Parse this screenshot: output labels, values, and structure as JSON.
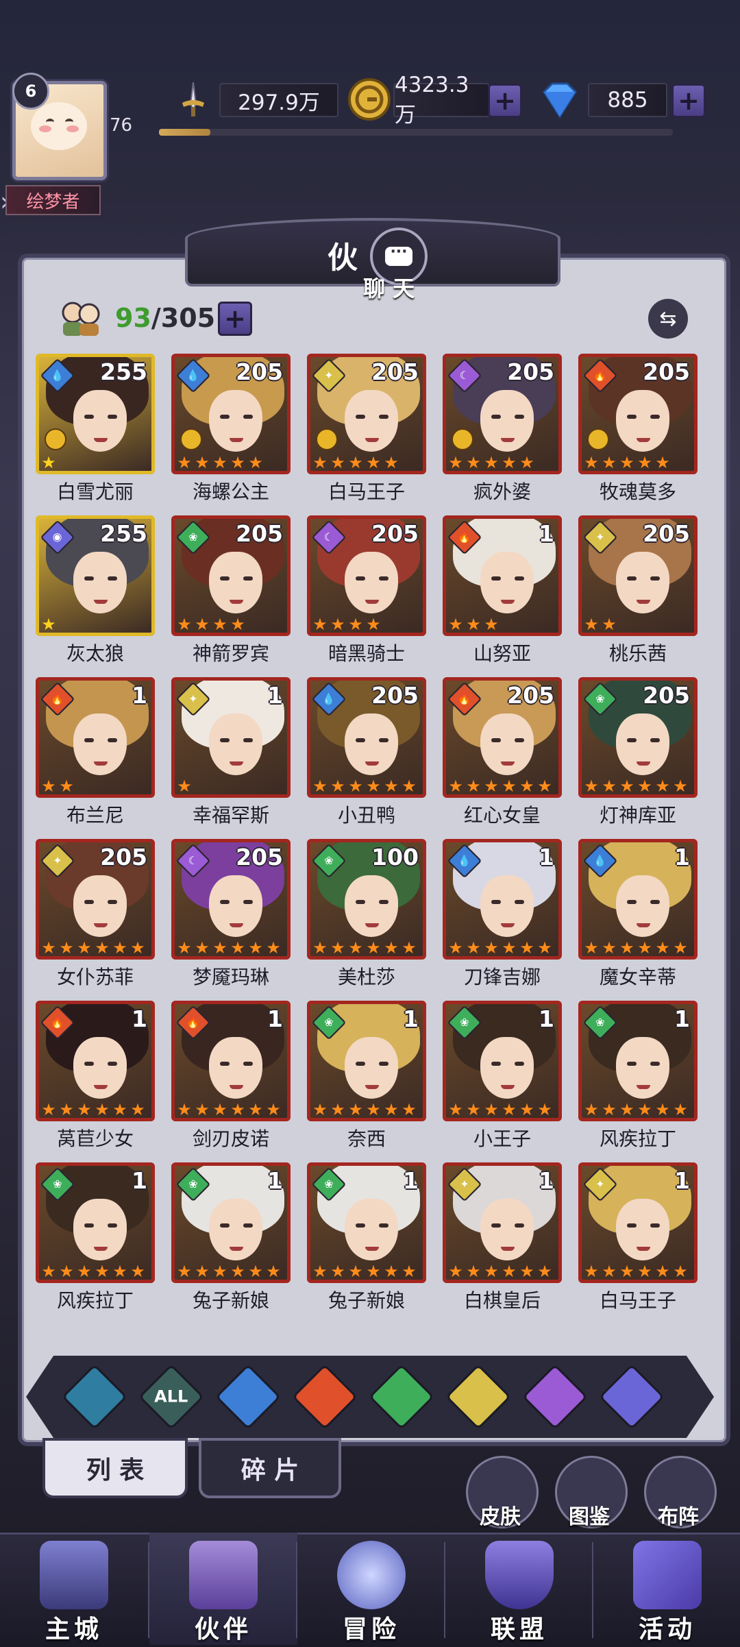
{
  "header": {
    "player_level": "6",
    "exp_value": "76",
    "exp_progress": 0.1,
    "player_name": "绘梦者",
    "power": "297.9万",
    "gold": "4323.3万",
    "gems": "885"
  },
  "panel": {
    "title": "伙",
    "chat_label": "聊 天",
    "count_current": "93",
    "count_total": "/305"
  },
  "heroes": [
    {
      "name": "白雪尤丽",
      "level": "255",
      "element": "water",
      "stars": 1,
      "frame": "gold",
      "crown": true
    },
    {
      "name": "海螺公主",
      "level": "205",
      "element": "water",
      "stars": 5,
      "frame": "red",
      "crown": true
    },
    {
      "name": "白马王子",
      "level": "205",
      "element": "light",
      "stars": 5,
      "frame": "red",
      "crown": true
    },
    {
      "name": "疯外婆",
      "level": "205",
      "element": "dark",
      "stars": 5,
      "frame": "red",
      "crown": true
    },
    {
      "name": "牧魂莫多",
      "level": "205",
      "element": "fire",
      "stars": 5,
      "frame": "red",
      "crown": true
    },
    {
      "name": "灰太狼",
      "level": "255",
      "element": "void",
      "stars": 1,
      "frame": "gold",
      "crown": false
    },
    {
      "name": "神箭罗宾",
      "level": "205",
      "element": "wind",
      "stars": 4,
      "frame": "red",
      "crown": false
    },
    {
      "name": "暗黑骑士",
      "level": "205",
      "element": "dark",
      "stars": 4,
      "frame": "red",
      "crown": false
    },
    {
      "name": "山努亚",
      "level": "1",
      "element": "fire",
      "stars": 3,
      "frame": "red",
      "crown": false
    },
    {
      "name": "桃乐茜",
      "level": "205",
      "element": "light",
      "stars": 2,
      "frame": "red",
      "crown": false
    },
    {
      "name": "布兰尼",
      "level": "1",
      "element": "fire",
      "stars": 2,
      "frame": "red",
      "crown": false
    },
    {
      "name": "幸福罕斯",
      "level": "1",
      "element": "light",
      "stars": 1,
      "frame": "red",
      "crown": false
    },
    {
      "name": "小丑鸭",
      "level": "205",
      "element": "water",
      "stars": 6,
      "frame": "red",
      "crown": false
    },
    {
      "name": "红心女皇",
      "level": "205",
      "element": "fire",
      "stars": 6,
      "frame": "red",
      "crown": false
    },
    {
      "name": "灯神库亚",
      "level": "205",
      "element": "wind",
      "stars": 6,
      "frame": "red",
      "crown": false
    },
    {
      "name": "女仆苏菲",
      "level": "205",
      "element": "light",
      "stars": 6,
      "frame": "red",
      "crown": false
    },
    {
      "name": "梦魇玛琳",
      "level": "205",
      "element": "dark",
      "stars": 6,
      "frame": "red",
      "crown": false
    },
    {
      "name": "美杜莎",
      "level": "100",
      "element": "wind",
      "stars": 6,
      "frame": "red",
      "crown": false
    },
    {
      "name": "刀锋吉娜",
      "level": "1",
      "element": "water",
      "stars": 6,
      "frame": "red",
      "crown": false
    },
    {
      "name": "魔女辛蒂",
      "level": "1",
      "element": "water",
      "stars": 6,
      "frame": "red",
      "crown": false
    },
    {
      "name": "莴苣少女",
      "level": "1",
      "element": "fire",
      "stars": 6,
      "frame": "red",
      "crown": false
    },
    {
      "name": "剑刃皮诺",
      "level": "1",
      "element": "fire",
      "stars": 6,
      "frame": "red",
      "crown": false
    },
    {
      "name": "奈西",
      "level": "1",
      "element": "wind",
      "stars": 6,
      "frame": "red",
      "crown": false
    },
    {
      "name": "小王子",
      "level": "1",
      "element": "wind",
      "stars": 6,
      "frame": "red",
      "crown": false
    },
    {
      "name": "风疾拉丁",
      "level": "1",
      "element": "wind",
      "stars": 6,
      "frame": "red",
      "crown": false
    },
    {
      "name": "风疾拉丁",
      "level": "1",
      "element": "wind",
      "stars": 6,
      "frame": "red",
      "crown": false
    },
    {
      "name": "兔子新娘",
      "level": "1",
      "element": "wind",
      "stars": 6,
      "frame": "red",
      "crown": false
    },
    {
      "name": "兔子新娘",
      "level": "1",
      "element": "wind",
      "stars": 6,
      "frame": "red",
      "crown": false
    },
    {
      "name": "白棋皇后",
      "level": "1",
      "element": "light",
      "stars": 6,
      "frame": "red",
      "crown": false
    },
    {
      "name": "白马王子",
      "level": "1",
      "element": "light",
      "stars": 6,
      "frame": "red",
      "crown": false
    }
  ],
  "element_colors": {
    "water": "#3d7ed6",
    "light": "#d9c04a",
    "dark": "#9b5bd4",
    "fire": "#e0502a",
    "wind": "#3fae5b",
    "void": "#6b66d8"
  },
  "filters": [
    {
      "name": "all-classes",
      "label": "",
      "color": "#2f7da0"
    },
    {
      "name": "all",
      "label": "ALL",
      "color": "#3a5f5a"
    },
    {
      "name": "water",
      "label": "",
      "color": "#3d7ed6"
    },
    {
      "name": "fire",
      "label": "",
      "color": "#e0502a"
    },
    {
      "name": "wind",
      "label": "",
      "color": "#3fae5b"
    },
    {
      "name": "light",
      "label": "",
      "color": "#d9c04a"
    },
    {
      "name": "dark",
      "label": "",
      "color": "#9b5bd4"
    },
    {
      "name": "void",
      "label": "",
      "color": "#6b66d8"
    }
  ],
  "tabs": {
    "list": "列 表",
    "fragments": "碎 片"
  },
  "quick_buttons": {
    "skin": "皮肤",
    "codex": "图鉴",
    "formation": "布阵"
  },
  "nav": {
    "main_city": "主城",
    "partners": "伙伴",
    "adventure": "冒险",
    "alliance": "联盟",
    "events": "活动"
  }
}
